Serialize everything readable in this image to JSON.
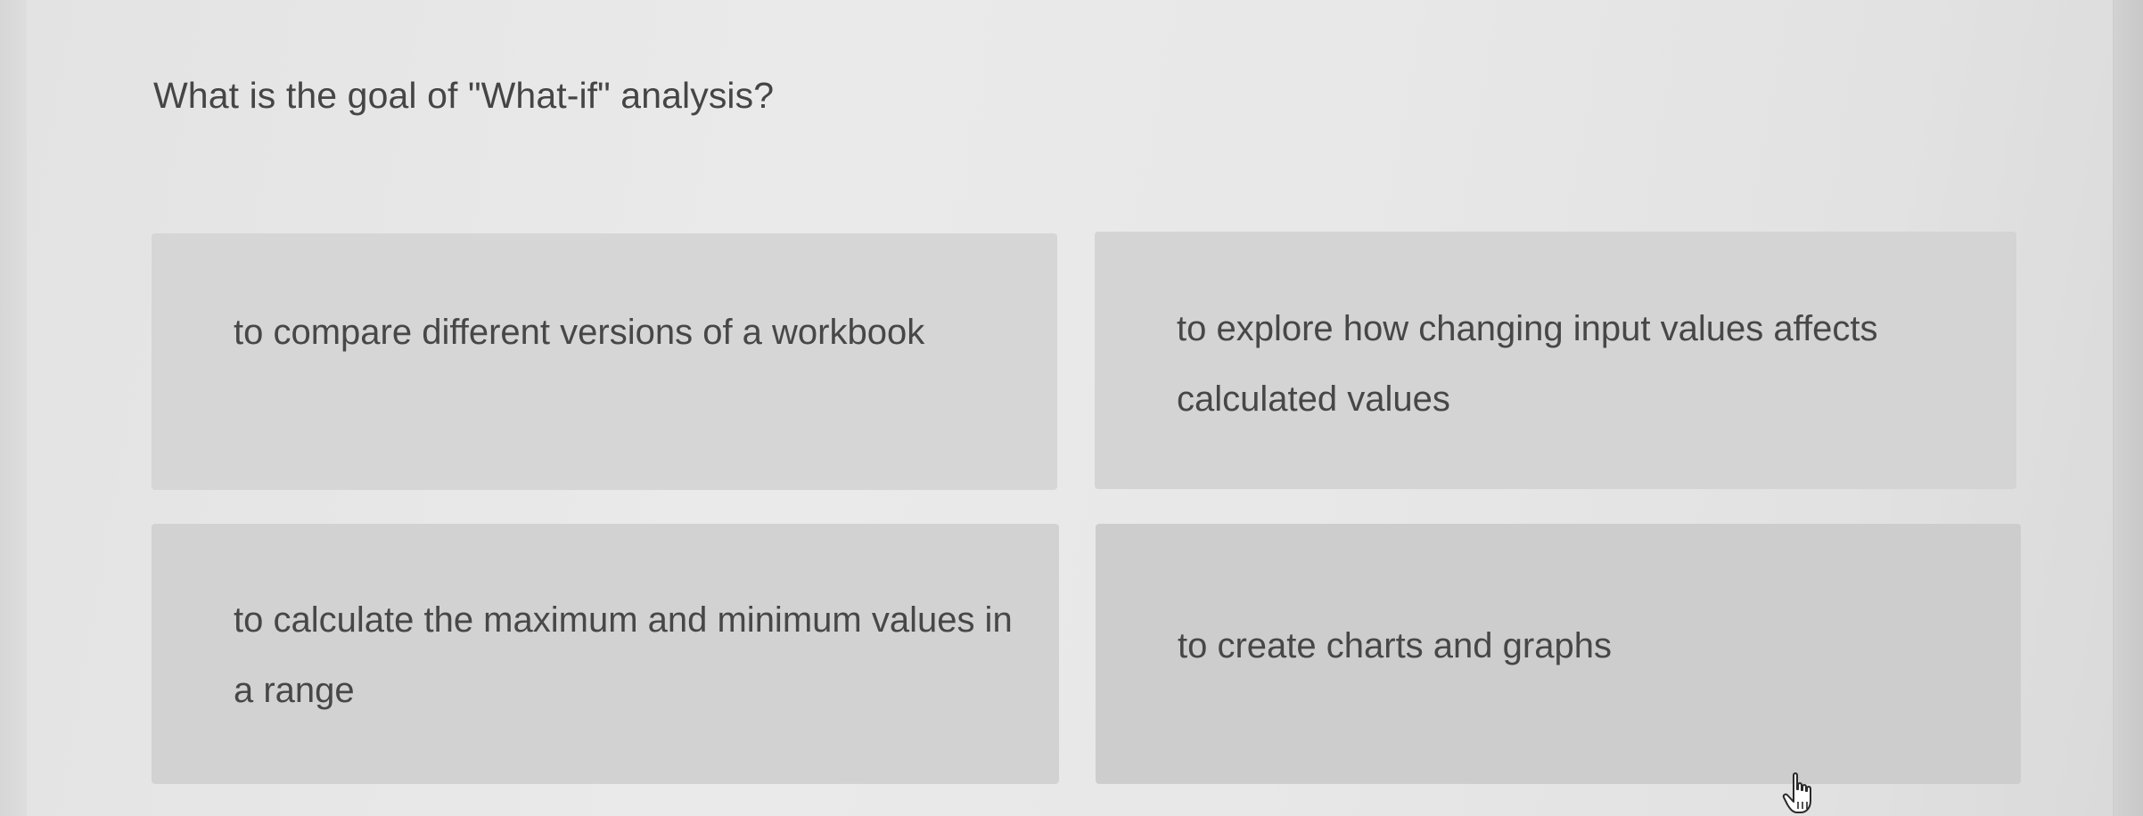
{
  "quiz": {
    "question": "What is the goal of \"What-if\" analysis?",
    "options": [
      {
        "label": "to compare different versions of a workbook"
      },
      {
        "label": "to explore how changing input values affects calculated values"
      },
      {
        "label": "to calculate the maximum and minimum values in a range"
      },
      {
        "label": "to create charts and graphs"
      }
    ]
  },
  "cursor": {
    "icon": "hand-pointer-icon"
  },
  "colors": {
    "background": "#e8e8e8",
    "option_background": "#d4d4d4",
    "text": "#474747"
  }
}
